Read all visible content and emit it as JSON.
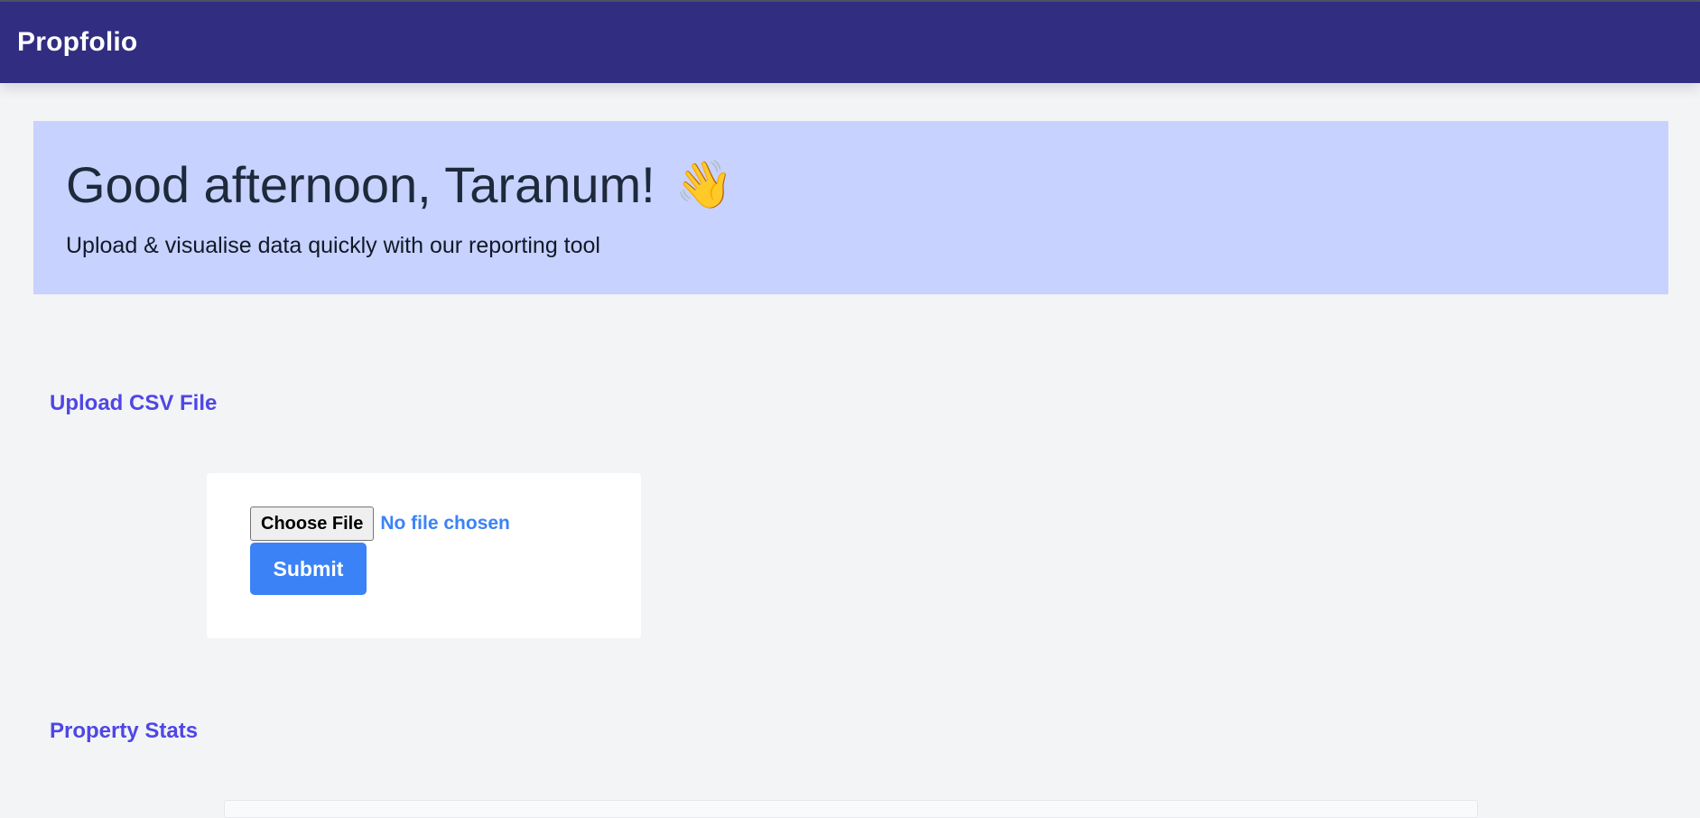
{
  "navbar": {
    "brand": "Propfolio"
  },
  "hero": {
    "greeting": "Good afternoon, Taranum!",
    "wave_icon": "👋",
    "subtitle": "Upload & visualise data quickly with our reporting tool"
  },
  "upload": {
    "section_title": "Upload CSV File",
    "choose_file_label": "Choose File",
    "file_status": "No file chosen",
    "submit_label": "Submit"
  },
  "stats": {
    "section_title": "Property Stats"
  },
  "colors": {
    "navbar_bg": "#312e81",
    "hero_bg": "#c7d2fe",
    "accent": "#4f46e5",
    "button_blue": "#3b82f6",
    "page_bg": "#f3f4f6"
  }
}
